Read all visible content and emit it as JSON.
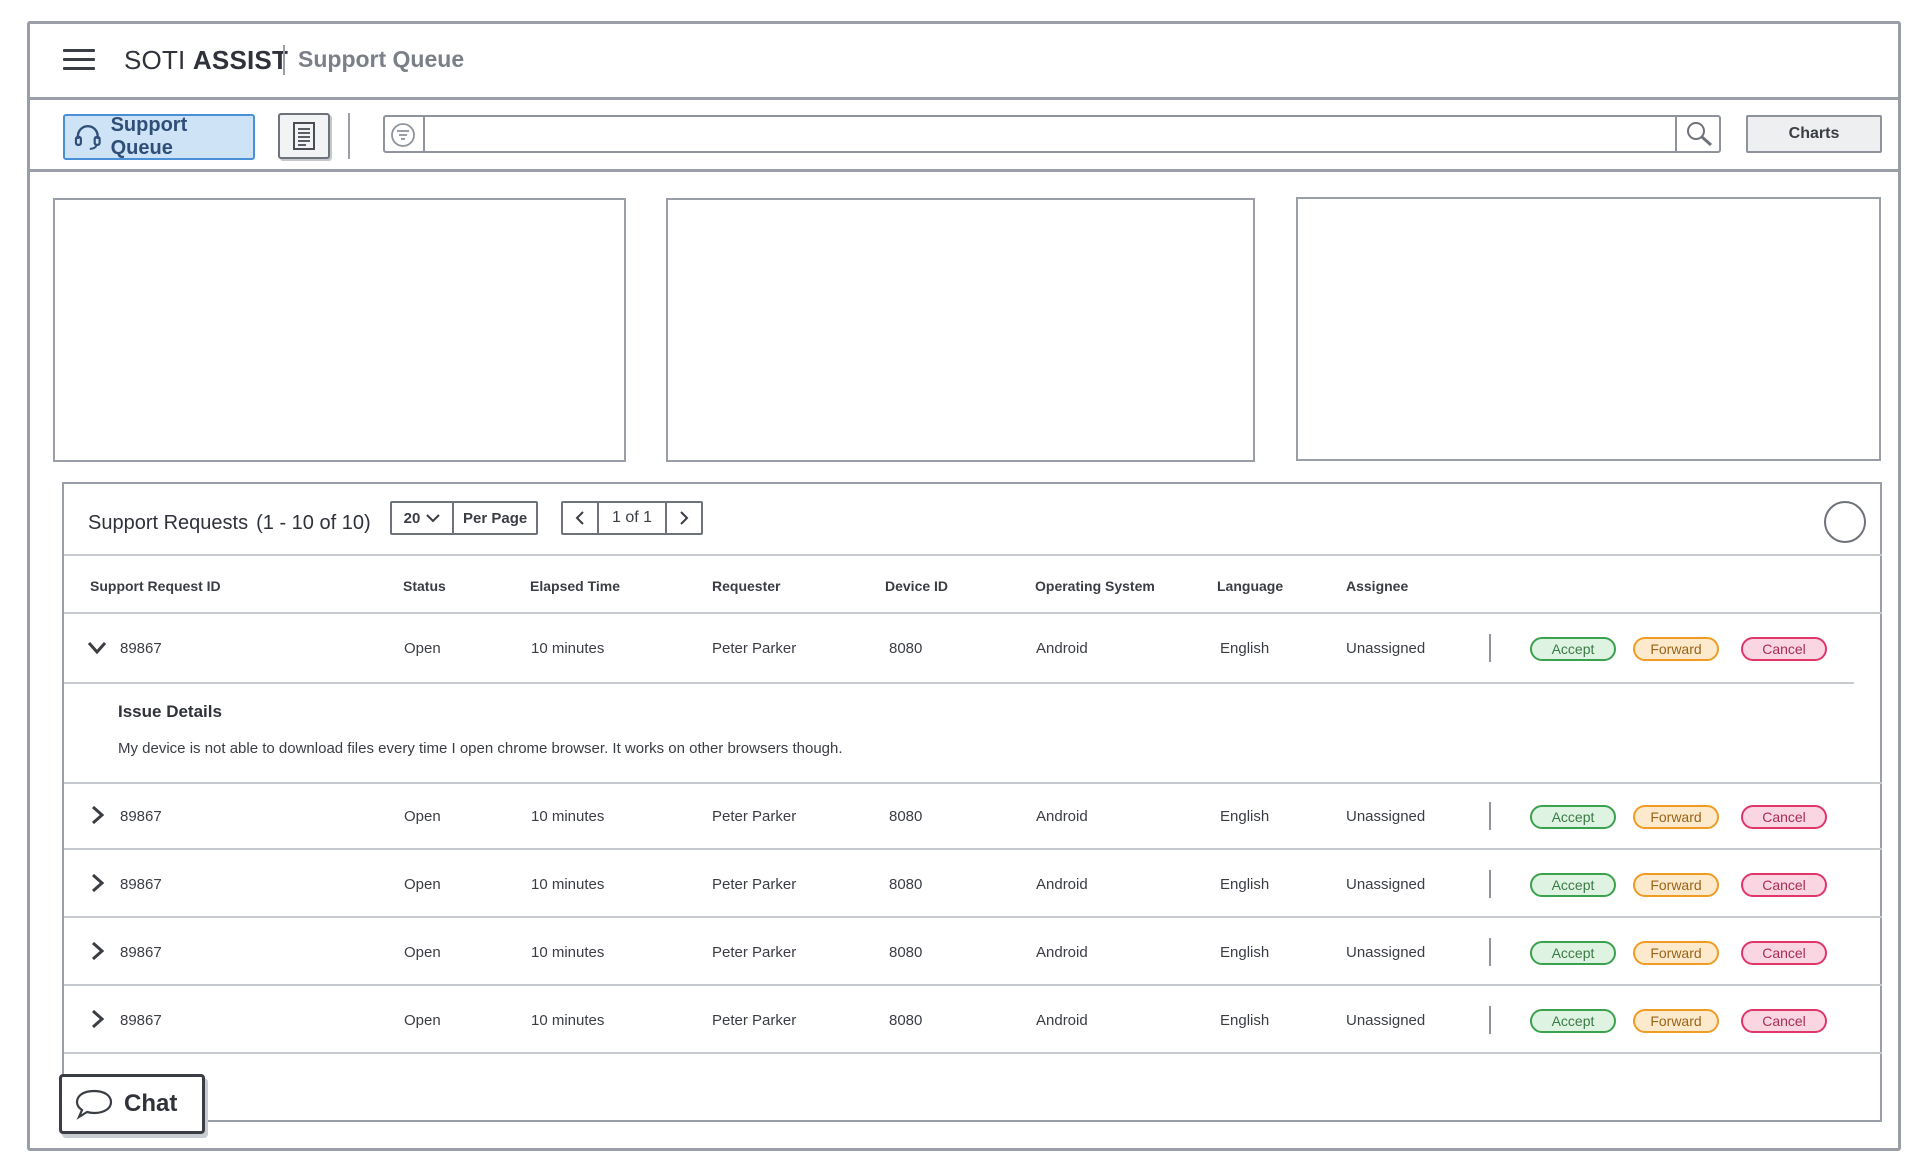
{
  "app": {
    "brand_light": "SOTI",
    "brand_bold": "ASSIST",
    "page_title": "Support Queue"
  },
  "toolbar": {
    "support_queue_label": "Support Queue",
    "search_placeholder": "",
    "charts_label": "Charts"
  },
  "requests": {
    "title": "Support Requests",
    "count": "(1 - 10 of 10)",
    "per_page_value": "20",
    "per_page_label": "Per Page",
    "page_indicator": "1 of 1",
    "columns": [
      "Support Request ID",
      "Status",
      "Elapsed Time",
      "Requester",
      "Device ID",
      "Operating System",
      "Language",
      "Assignee"
    ],
    "rows": [
      {
        "id": "89867",
        "status": "Open",
        "elapsed": "10 minutes",
        "requester": "Peter Parker",
        "device": "8080",
        "os": "Android",
        "language": "English",
        "assignee": "Unassigned",
        "expanded": true
      },
      {
        "id": "89867",
        "status": "Open",
        "elapsed": "10 minutes",
        "requester": "Peter Parker",
        "device": "8080",
        "os": "Android",
        "language": "English",
        "assignee": "Unassigned",
        "expanded": false
      },
      {
        "id": "89867",
        "status": "Open",
        "elapsed": "10 minutes",
        "requester": "Peter Parker",
        "device": "8080",
        "os": "Android",
        "language": "English",
        "assignee": "Unassigned",
        "expanded": false
      },
      {
        "id": "89867",
        "status": "Open",
        "elapsed": "10 minutes",
        "requester": "Peter Parker",
        "device": "8080",
        "os": "Android",
        "language": "English",
        "assignee": "Unassigned",
        "expanded": false
      },
      {
        "id": "89867",
        "status": "Open",
        "elapsed": "10 minutes",
        "requester": "Peter Parker",
        "device": "8080",
        "os": "Android",
        "language": "English",
        "assignee": "Unassigned",
        "expanded": false
      }
    ],
    "actions": {
      "accept": "Accept",
      "forward": "Forward",
      "cancel": "Cancel"
    },
    "details": {
      "title": "Issue Details",
      "text": "My device is not able to download files every time I open chrome browser. It works on other browsers though."
    }
  },
  "chat": {
    "label": "Chat"
  },
  "colors": {
    "accent": "#4a90d6",
    "accept": "#3aa14d",
    "forward": "#f09b24",
    "cancel": "#e0366a",
    "border": "#9a9ea6"
  },
  "icons": [
    "hamburger-menu-icon",
    "headset-icon",
    "document-icon",
    "filter-icon",
    "search-icon",
    "chevron-down-icon",
    "chevron-right-icon",
    "chevron-left-icon",
    "chat-bubble-icon",
    "refresh-circle-icon"
  ]
}
